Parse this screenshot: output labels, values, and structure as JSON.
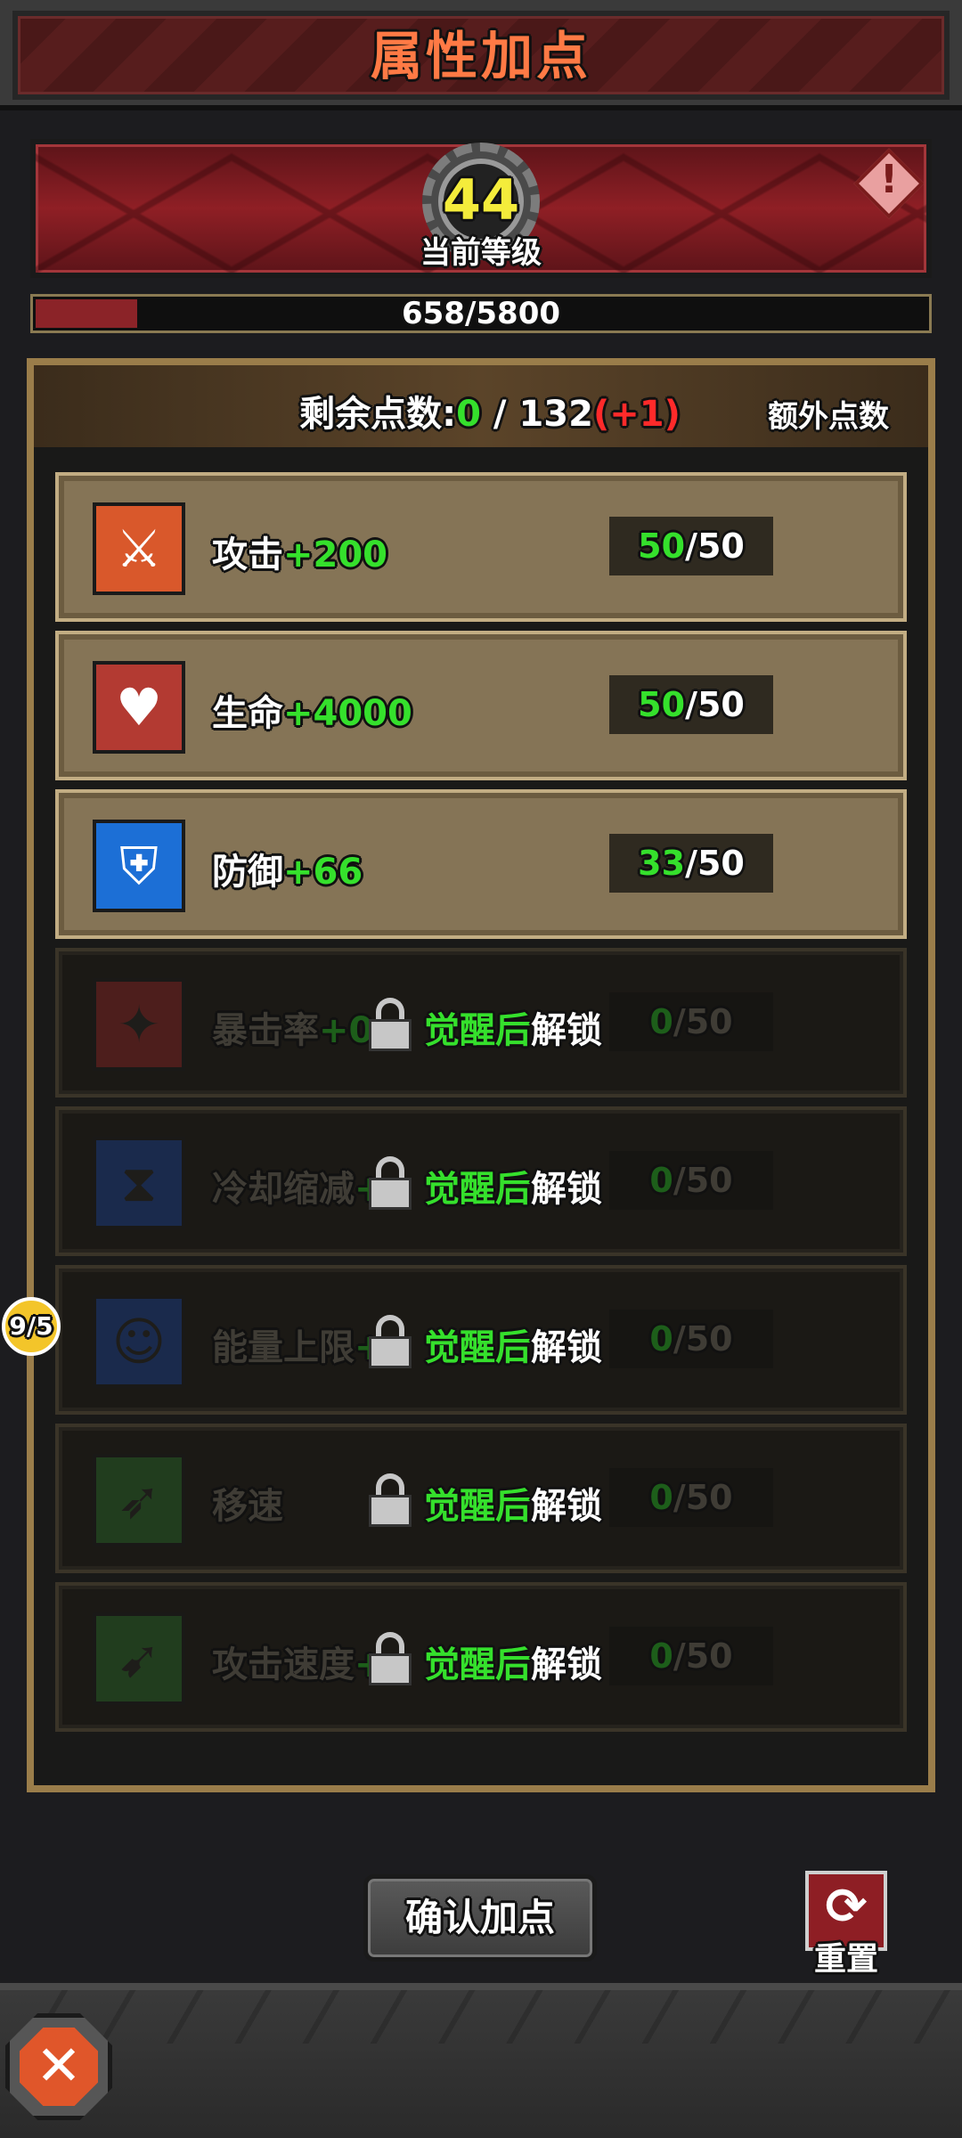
{
  "header": {
    "title": "属性加点"
  },
  "level": {
    "value": "44",
    "caption": "当前等级"
  },
  "exp": {
    "text": "658/5800",
    "fill_fraction": 0.113
  },
  "points": {
    "label": "剩余点数:",
    "remaining": "0",
    "separator": " / ",
    "total": "132",
    "bonus": "(+1)",
    "extra_label": "额外点数"
  },
  "stats": [
    {
      "name": "攻击",
      "bonus": "+200",
      "current": "50",
      "max": "/50",
      "icon": "sword-icon",
      "color": "#d9582b",
      "locked": false
    },
    {
      "name": "生命",
      "bonus": "+4000",
      "current": "50",
      "max": "/50",
      "icon": "heart-icon",
      "color": "#b33a32",
      "locked": false
    },
    {
      "name": "防御",
      "bonus": "+66",
      "current": "33",
      "max": "/50",
      "icon": "shield-icon",
      "color": "#1c6fd6",
      "locked": false
    },
    {
      "name": "暴击率",
      "bonus": "+0",
      "current": "0",
      "max": "/50",
      "icon": "crit-icon",
      "color": "#8a2626",
      "locked": true
    },
    {
      "name": "冷却缩减",
      "bonus": "+",
      "current": "0",
      "max": "/50",
      "icon": "hourglass-icon",
      "color": "#1a3f8f",
      "locked": true
    },
    {
      "name": "能量上限",
      "bonus": "+",
      "current": "0",
      "max": "/50",
      "icon": "energy-icon",
      "color": "#1a3f8f",
      "locked": true
    },
    {
      "name": "移速",
      "bonus": "",
      "current": "0",
      "max": "/50",
      "icon": "speed-icon",
      "color": "#2a6a2a",
      "locked": true
    },
    {
      "name": "攻击速度",
      "bonus": "+",
      "current": "0",
      "max": "/50",
      "icon": "attack-speed-icon",
      "color": "#2a6a2a",
      "locked": true
    }
  ],
  "unlock": {
    "highlight": "觉醒后",
    "rest": "解锁"
  },
  "side_badge": "9/5",
  "buttons": {
    "confirm": "确认加点",
    "reset": "重置"
  },
  "colors": {
    "accent_green": "#35e02c",
    "accent_red": "#ff2a2a",
    "title_orange": "#ff7a45",
    "level_yellow": "#f4ec3b"
  }
}
